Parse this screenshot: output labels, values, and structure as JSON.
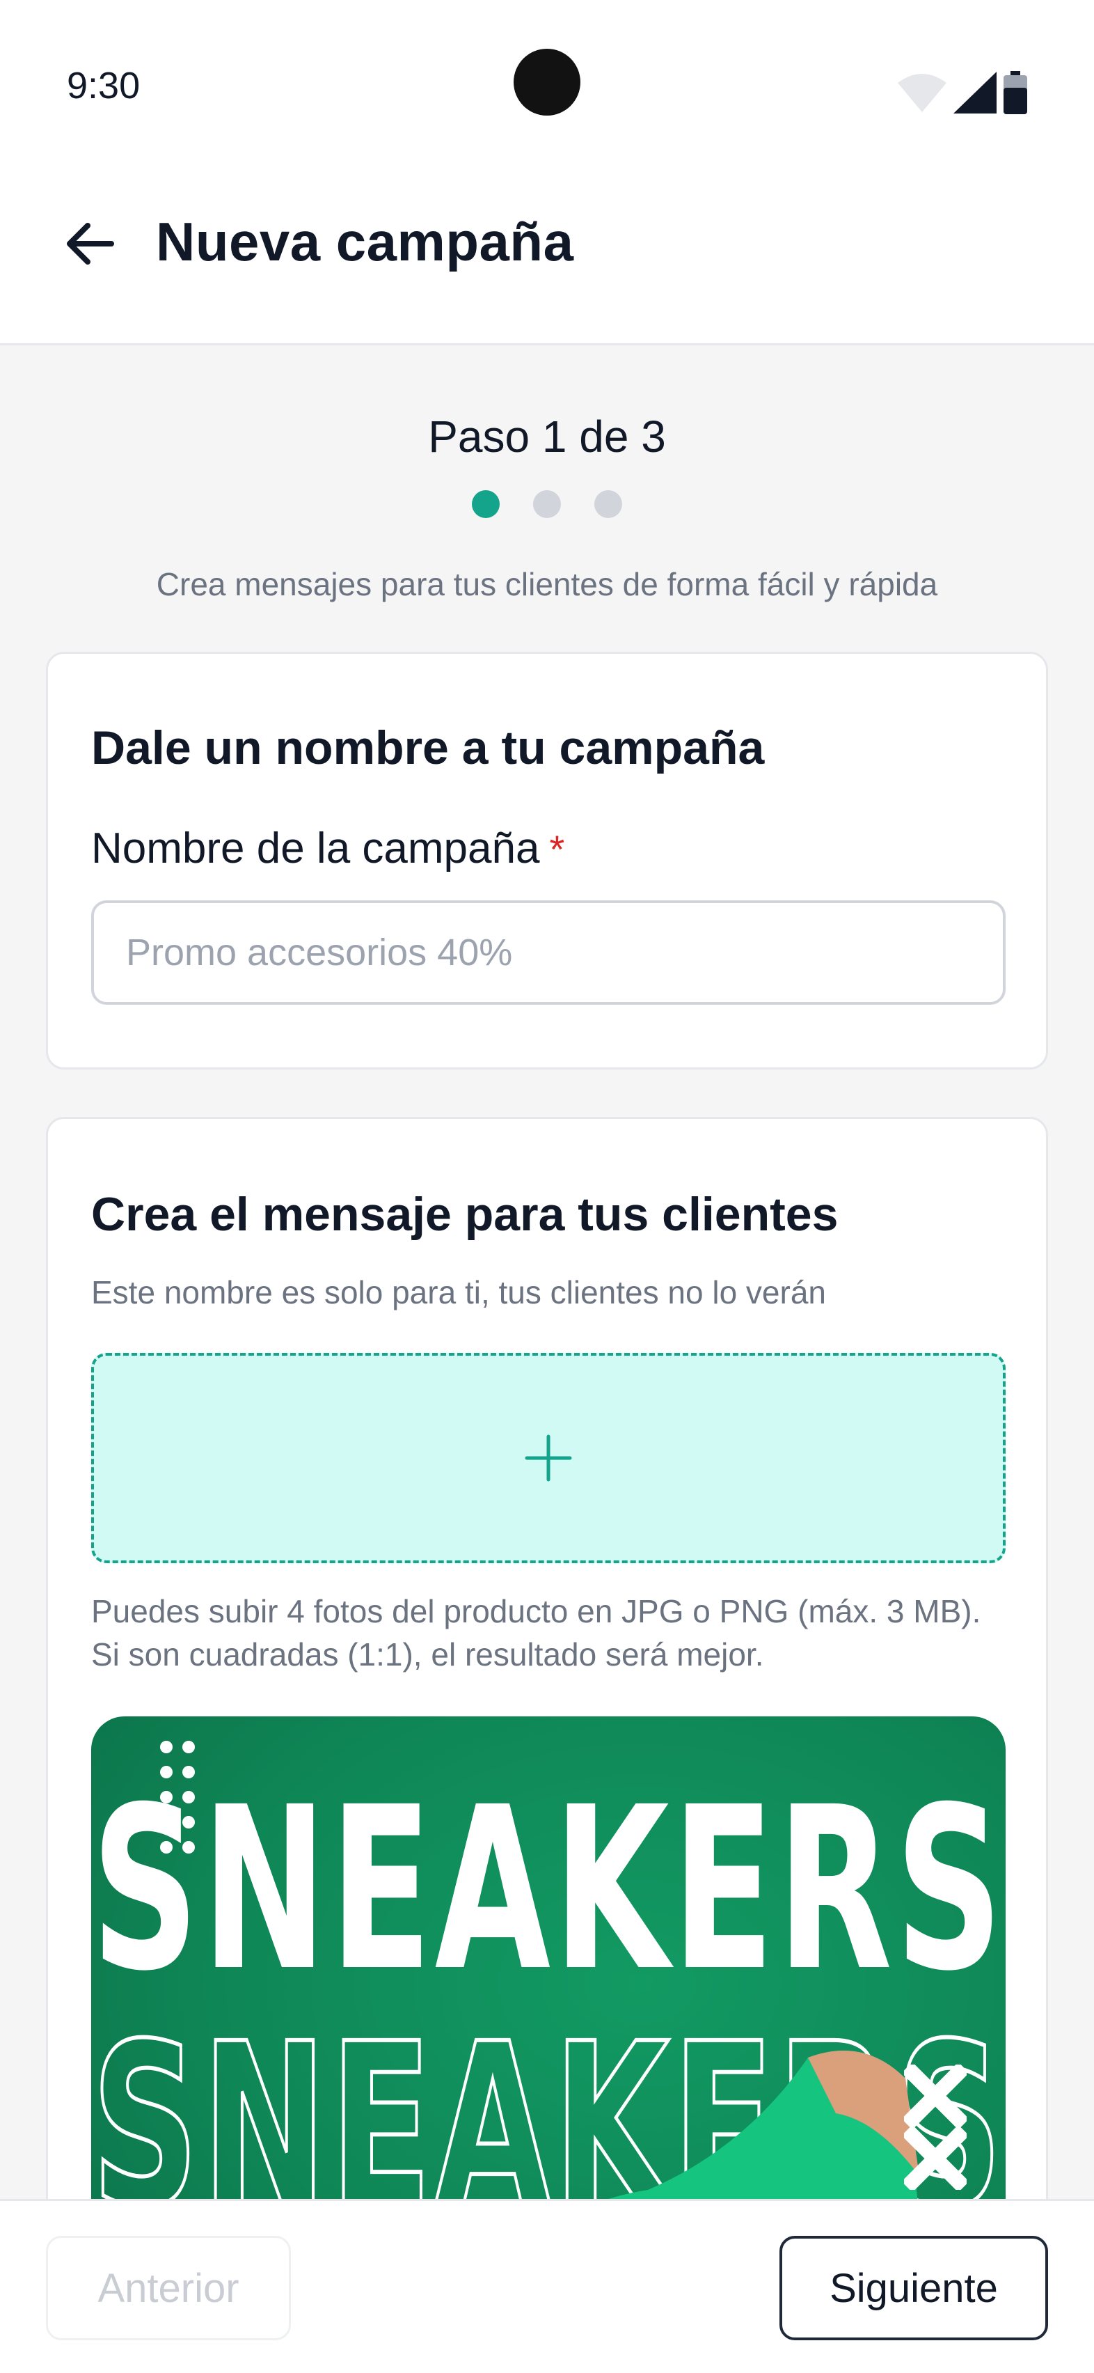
{
  "status_bar": {
    "time": "9:30"
  },
  "header": {
    "title": "Nueva campaña",
    "back_icon": "arrow-left-icon"
  },
  "stepper": {
    "label": "Paso 1 de 3",
    "current_step": 1,
    "total_steps": 3,
    "subtitle": "Crea mensajes para tus clientes de forma fácil y rápida",
    "active_color": "#14a38b"
  },
  "name_card": {
    "title": "Dale un nombre a tu campaña",
    "field_label": "Nombre de la campaña",
    "required_mark": "*",
    "input_value": "",
    "input_placeholder": "Promo accesorios 40%"
  },
  "message_card": {
    "title": "Crea el mensaje para tus clientes",
    "subtitle": "Este nombre es solo para ti, tus clientes no lo verán",
    "upload_icon": "plus-icon",
    "upload_help": "Puedes subir 4 fotos del producto en JPG o PNG (máx. 3 MB). Si son cuadradas (1:1), el resultado será mejor.",
    "preview": {
      "headline": "SNEAKERS",
      "background_color": "#0f8656"
    }
  },
  "footer": {
    "prev_label": "Anterior",
    "next_label": "Siguiente"
  }
}
